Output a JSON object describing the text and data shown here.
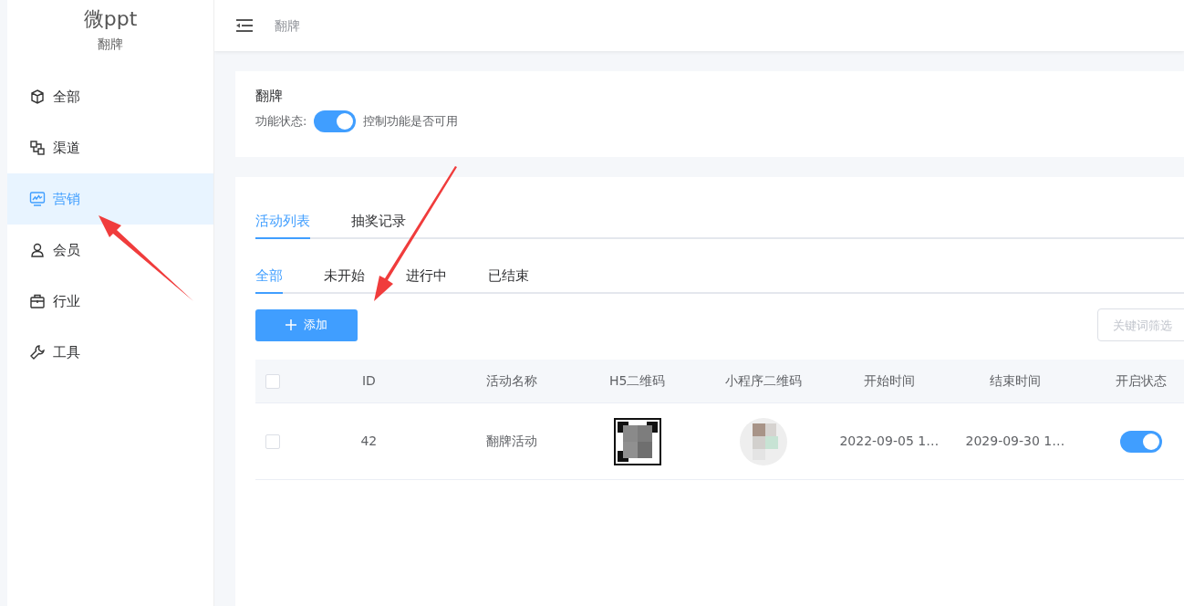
{
  "app": {
    "title": "微ppt",
    "subtitle": "翻牌"
  },
  "sidebar": {
    "items": [
      {
        "label": "全部",
        "kind": "cube",
        "selected": false
      },
      {
        "label": "渠道",
        "kind": "nodes",
        "selected": false
      },
      {
        "label": "营销",
        "kind": "monitor",
        "selected": true
      },
      {
        "label": "会员",
        "kind": "user",
        "selected": false
      },
      {
        "label": "行业",
        "kind": "briefcase",
        "selected": false
      },
      {
        "label": "工具",
        "kind": "wrench",
        "selected": false
      }
    ]
  },
  "header": {
    "breadcrumb": "翻牌"
  },
  "feature": {
    "title": "翻牌",
    "label": "功能状态:",
    "on": true,
    "hint": "控制功能是否可用"
  },
  "tabs": [
    {
      "label": "活动列表",
      "selected": true
    },
    {
      "label": "抽奖记录",
      "selected": false
    }
  ],
  "filters": [
    {
      "label": "全部",
      "selected": true
    },
    {
      "label": "未开始",
      "selected": false
    },
    {
      "label": "进行中",
      "selected": false
    },
    {
      "label": "已结束",
      "selected": false
    }
  ],
  "add_button": "添加",
  "keyword_filter": {
    "placeholder": "关键词筛选"
  },
  "table": {
    "header_checked": false,
    "columns": [
      "ID",
      "活动名称",
      "H5二维码",
      "小程序二维码",
      "开始时间",
      "结束时间",
      "开启状态"
    ],
    "rows": [
      {
        "checked": false,
        "id": "42",
        "name": "翻牌活动",
        "start": "2022-09-05 1…",
        "end": "2029-09-30 1…",
        "on": true
      }
    ]
  }
}
